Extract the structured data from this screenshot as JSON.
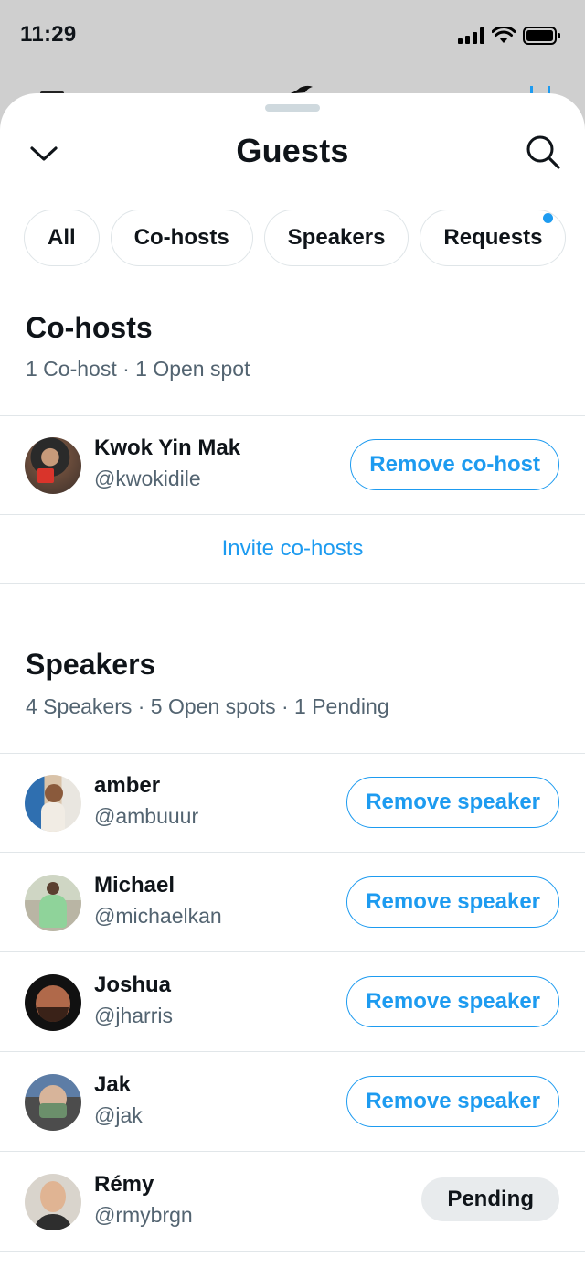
{
  "status_bar": {
    "time": "11:29"
  },
  "header": {
    "title": "Guests"
  },
  "filters": [
    "All",
    "Co-hosts",
    "Speakers",
    "Requests"
  ],
  "cohosts": {
    "title": "Co-hosts",
    "summary": "1 Co-host · 1 Open spot",
    "items": [
      {
        "name": "Kwok Yin Mak",
        "handle": "@kwokidile",
        "action": "Remove co-host"
      }
    ],
    "invite_label": "Invite co-hosts"
  },
  "speakers": {
    "title": "Speakers",
    "summary": "4 Speakers · 5 Open spots · 1 Pending",
    "items": [
      {
        "name": "amber",
        "handle": "@ambuuur",
        "action": "Remove speaker"
      },
      {
        "name": "Michael",
        "handle": "@michaelkan",
        "action": "Remove speaker"
      },
      {
        "name": "Joshua",
        "handle": "@jharris",
        "action": "Remove speaker"
      },
      {
        "name": "Jak",
        "handle": "@jak",
        "action": "Remove speaker"
      },
      {
        "name": "Rémy",
        "handle": "@rmybrgn",
        "action": "Pending"
      }
    ]
  },
  "colors": {
    "accent": "#1d9bf0",
    "text": "#0f1419",
    "secondary": "#536471",
    "notification_dot": "#1d9bf0"
  }
}
